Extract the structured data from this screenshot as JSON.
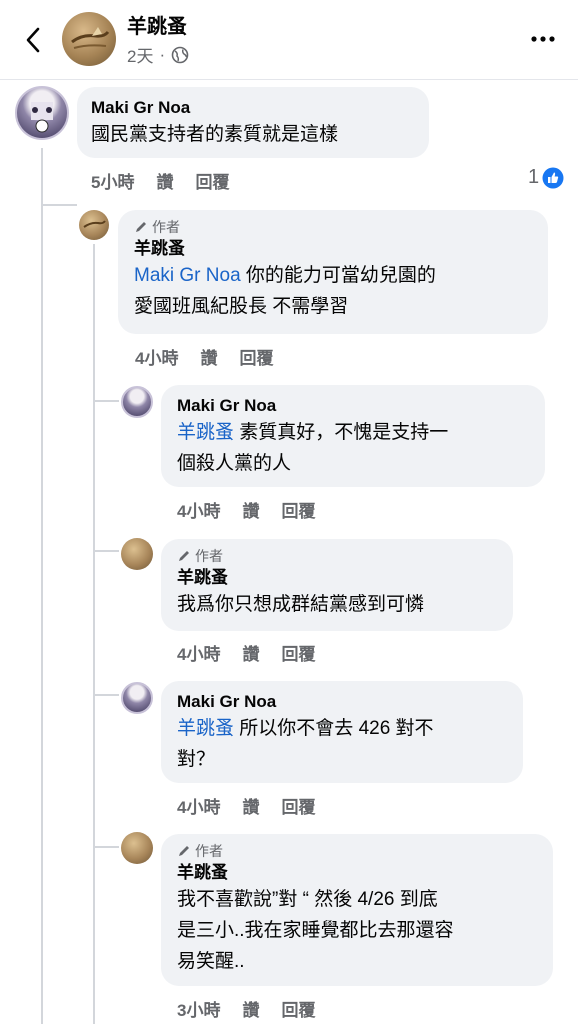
{
  "header": {
    "title": "羊跳蚤",
    "time": "2天",
    "dot": "·"
  },
  "comments": [
    {
      "author": "Maki Gr Noa",
      "text": "國民黨支持者的素質就是這樣",
      "time": "5小時",
      "like": "讚",
      "reply": "回覆",
      "reaction_count": "1"
    },
    {
      "author_tag": "作者",
      "author": "羊跳蚤",
      "mention": "Maki Gr Noa",
      "text_line1": " 你的能力可當幼兒園的",
      "text_line2": "愛國班風紀股長 不需學習",
      "time": "4小時",
      "like": "讚",
      "reply": "回覆"
    },
    {
      "author": "Maki Gr Noa",
      "mention": "羊跳蚤",
      "text_line1": " 素質真好，不愧是支持一",
      "text_line2": "個殺人黨的人",
      "time": "4小時",
      "like": "讚",
      "reply": "回覆"
    },
    {
      "author_tag": "作者",
      "author": "羊跳蚤",
      "text": "我爲你只想成群結黨感到可憐",
      "time": "4小時",
      "like": "讚",
      "reply": "回覆"
    },
    {
      "author": "Maki Gr Noa",
      "mention": "羊跳蚤",
      "text_line1": " 所以你不會去 426 對不",
      "text_line2": "對？",
      "time": "4小時",
      "like": "讚",
      "reply": "回覆"
    },
    {
      "author_tag": "作者",
      "author": "羊跳蚤",
      "text_line1": "我不喜歡說”對 “ 然後 4/26 到底",
      "text_line2": "是三小..我在家睡覺都比去那還容",
      "text_line3": "易笑醒..",
      "time": "3小時",
      "like": "讚",
      "reply": "回覆"
    }
  ],
  "colors": {
    "mention": "#1a64c8",
    "bubble": "#f0f2f5",
    "meta": "#65676b",
    "like_badge": "#1877f2"
  },
  "icons": [
    "back-icon",
    "globe-icon",
    "more-icon",
    "pencil-icon",
    "thumbs-up-icon"
  ]
}
